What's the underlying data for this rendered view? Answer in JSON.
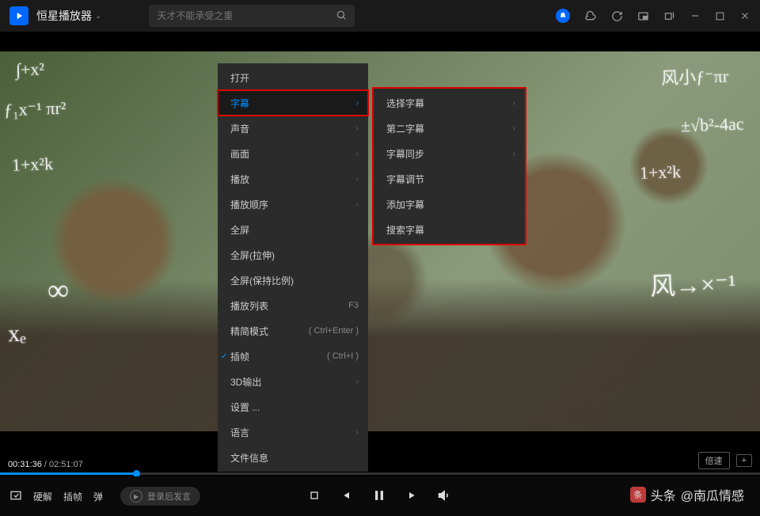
{
  "titlebar": {
    "app_name": "恒星播放器",
    "search_placeholder": "天才不能承受之重"
  },
  "context_menu": {
    "items": [
      {
        "label": "打开",
        "has_arrow": false
      },
      {
        "label": "字幕",
        "has_arrow": true,
        "active": true,
        "highlighted": true
      },
      {
        "label": "声音",
        "has_arrow": true
      },
      {
        "label": "画面",
        "has_arrow": true
      },
      {
        "label": "播放",
        "has_arrow": true
      },
      {
        "label": "播放顺序",
        "has_arrow": true
      },
      {
        "label": "全屏",
        "has_arrow": false
      },
      {
        "label": "全屏(拉伸)",
        "has_arrow": false
      },
      {
        "label": "全屏(保持比例)",
        "has_arrow": false
      },
      {
        "label": "播放列表",
        "shortcut": "F3"
      },
      {
        "label": "精简模式",
        "shortcut": "( Ctrl+Enter )"
      },
      {
        "label": "插帧",
        "shortcut": "( Ctrl+I )",
        "checked": true
      },
      {
        "label": "3D输出",
        "has_arrow": true
      },
      {
        "label": "设置 ...",
        "has_arrow": false
      },
      {
        "label": "语言",
        "has_arrow": true
      },
      {
        "label": "文件信息",
        "has_arrow": false
      }
    ]
  },
  "submenu": {
    "items": [
      {
        "label": "选择字幕",
        "has_arrow": true
      },
      {
        "label": "第二字幕",
        "has_arrow": true
      },
      {
        "label": "字幕同步",
        "has_arrow": true
      },
      {
        "label": "字幕调节"
      },
      {
        "label": "添加字幕"
      },
      {
        "label": "搜索字幕"
      }
    ]
  },
  "playback": {
    "current_time": "00:31:36",
    "total_time": "02:51:07",
    "speed_label": "倍速"
  },
  "controls": {
    "hw_decode": "硬解",
    "frame_interp": "插帧",
    "danmu": "弹",
    "login_hint": "登录后发言"
  },
  "watermark": {
    "prefix": "头条",
    "author": "@南瓜情感"
  }
}
